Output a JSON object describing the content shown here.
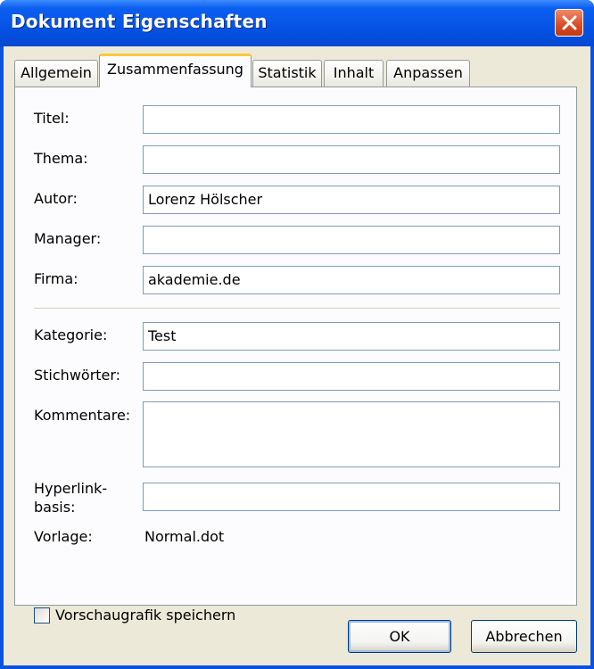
{
  "window": {
    "title": "Dokument Eigenschaften"
  },
  "tabs": [
    {
      "label": "Allgemein",
      "active": false
    },
    {
      "label": "Zusammenfassung",
      "active": true
    },
    {
      "label": "Statistik",
      "active": false
    },
    {
      "label": "Inhalt",
      "active": false
    },
    {
      "label": "Anpassen",
      "active": false
    }
  ],
  "fields": {
    "titel": {
      "label": "Titel:",
      "value": ""
    },
    "thema": {
      "label": "Thema:",
      "value": ""
    },
    "autor": {
      "label": "Autor:",
      "value": "Lorenz Hölscher"
    },
    "manager": {
      "label": "Manager:",
      "value": ""
    },
    "firma": {
      "label": "Firma:",
      "value": "akademie.de"
    },
    "kategorie": {
      "label": "Kategorie:",
      "value": "Test"
    },
    "stichwoerter": {
      "label": "Stichwörter:",
      "value": ""
    },
    "kommentare": {
      "label": "Kommentare:",
      "value": ""
    },
    "hyperlinkbasis": {
      "label_line1": "Hyperlink-",
      "label_line2": "basis:",
      "value": ""
    }
  },
  "vorlage": {
    "label": "Vorlage:",
    "value": "Normal.dot"
  },
  "preview_checkbox": {
    "label": "Vorschaugrafik speichern",
    "checked": false
  },
  "buttons": {
    "ok": "OK",
    "cancel": "Abbrechen"
  },
  "colors": {
    "titlebar": "#0553e4",
    "dialog_bg": "#ece9d8",
    "active_tab_accent": "#ffc83c",
    "close_button": "#d94b25"
  }
}
